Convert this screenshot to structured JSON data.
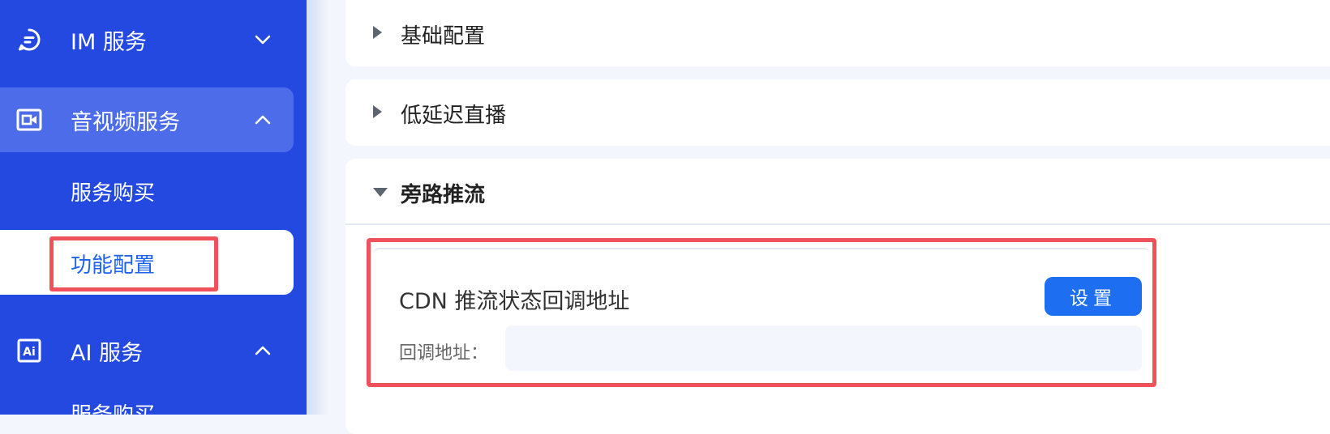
{
  "sidebar": {
    "groups": [
      {
        "label": "IM 服务",
        "icon": "chat-bubble-icon",
        "state": "collapsed"
      },
      {
        "label": "音视频服务",
        "icon": "video-call-icon",
        "state": "expanded"
      },
      {
        "label": "AI 服务",
        "icon": "ai-icon",
        "state": "expanded"
      }
    ],
    "av_items": [
      {
        "label": "服务购买"
      },
      {
        "label": "功能配置",
        "active": true
      }
    ],
    "ai_items": [
      {
        "label": "服务购买"
      }
    ]
  },
  "main": {
    "sections": [
      {
        "title": "基础配置",
        "expanded": false
      },
      {
        "title": "低延迟直播",
        "expanded": false
      },
      {
        "title": "旁路推流",
        "expanded": true
      }
    ],
    "callback_card": {
      "title": "CDN 推流状态回调地址",
      "button_label": "设置",
      "field_label": "回调地址：",
      "field_value": ""
    }
  },
  "colors": {
    "sidebar_bg": "#2449e0",
    "sidebar_active_group": "#4d6cea",
    "accent": "#1d6ef0",
    "highlight": "#f0525c",
    "active_text": "#1e63ee"
  }
}
